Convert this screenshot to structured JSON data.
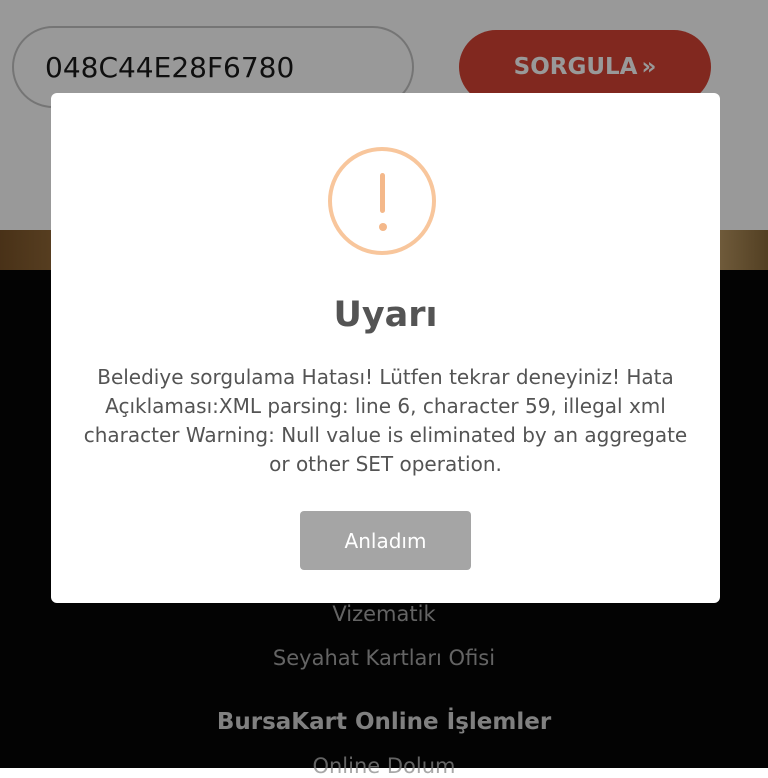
{
  "colors": {
    "accent_button": "#d84334",
    "warning_icon": "#f8c69c",
    "confirm_button": "#a5a5a5",
    "footer_bg": "#050505"
  },
  "search": {
    "card_value": "048C44E28F6780",
    "query_label": "SORGULA",
    "query_icon": "double-chevron-right-icon",
    "query_icon_glyph": "»"
  },
  "footer": {
    "links": [
      "Vizematik",
      "Seyahat Kartları Ofisi"
    ],
    "heading": "BursaKart Online İşlemler",
    "sublink": "Online Dolum"
  },
  "dialog": {
    "icon": "warning-exclamation-icon",
    "title": "Uyarı",
    "message": "Belediye sorgulama Hatası! Lütfen tekrar deneyiniz! Hata Açıklaması:XML parsing: line 6, character 59, illegal xml character Warning: Null value is eliminated by an aggregate or other SET operation.",
    "confirm_label": "Anladım"
  }
}
